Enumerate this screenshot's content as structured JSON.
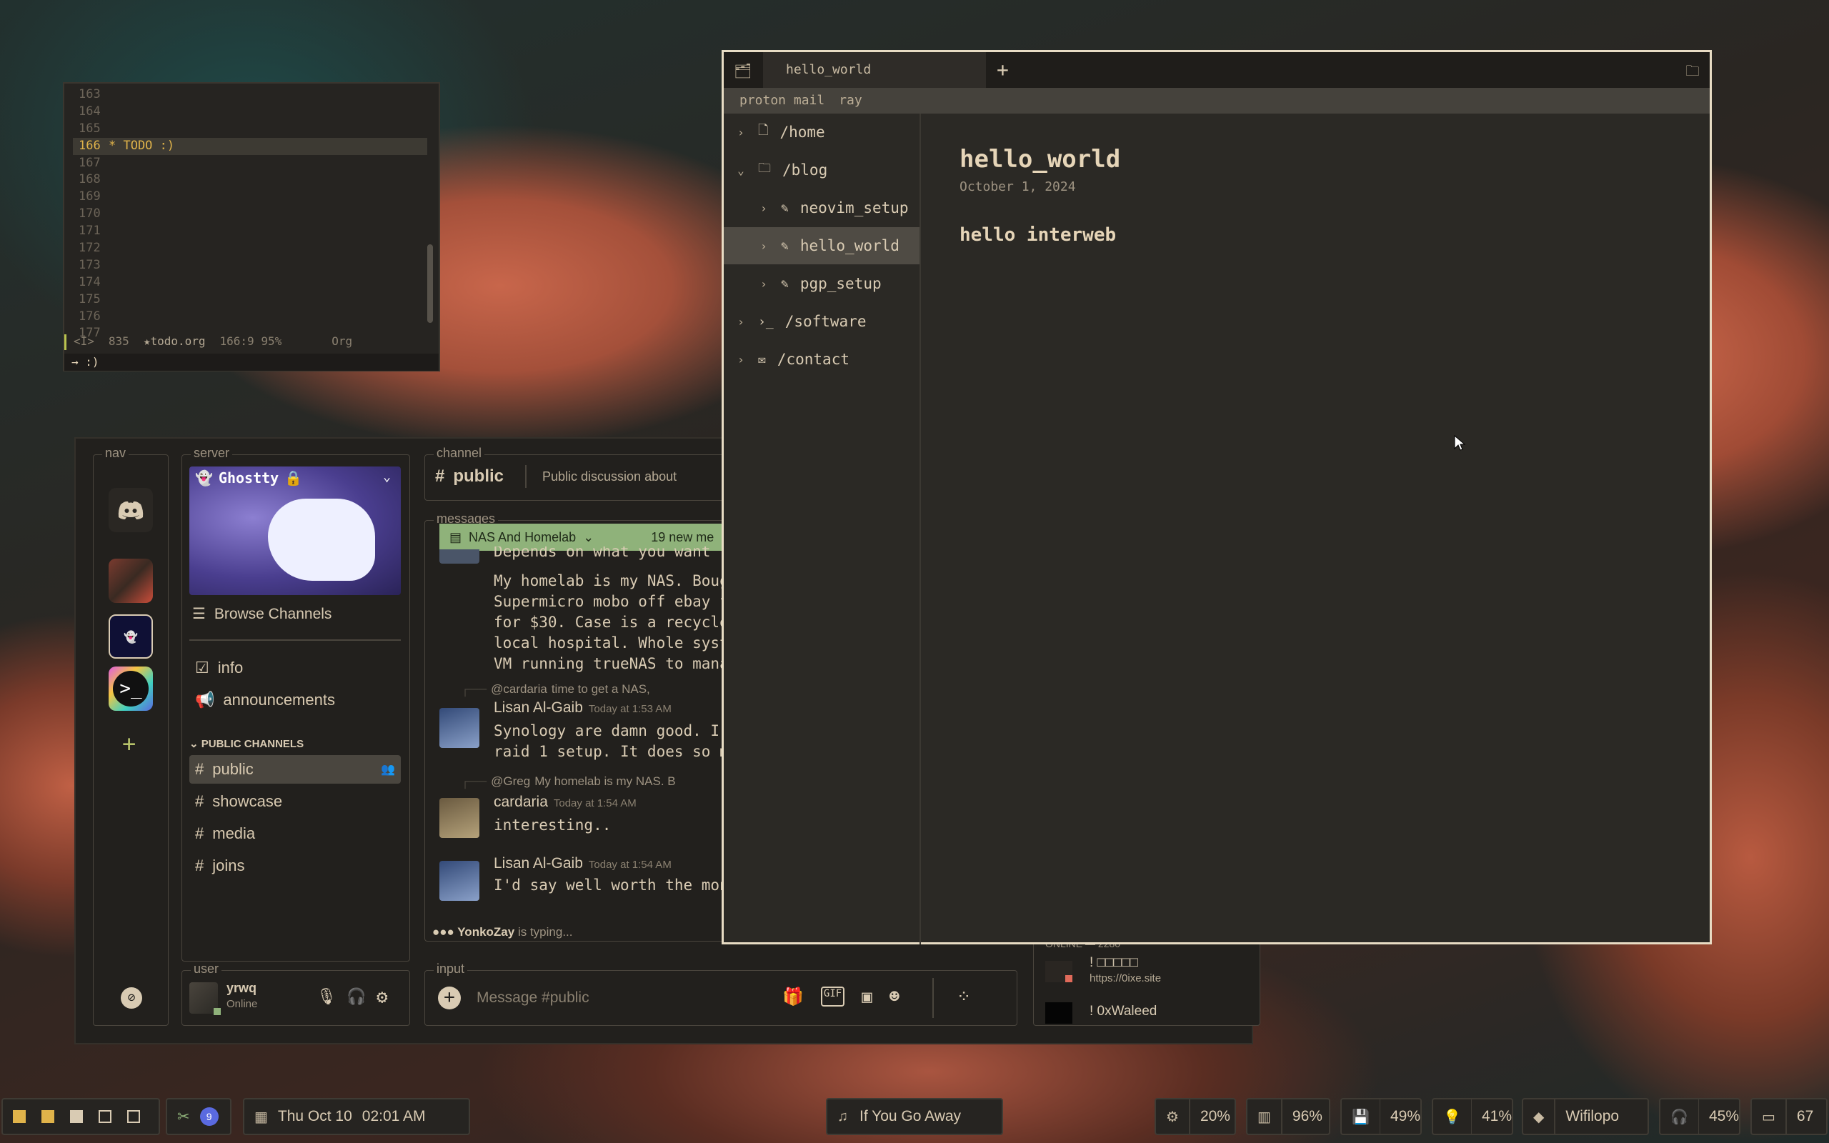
{
  "editor": {
    "lines": [
      {
        "n": "163",
        "t": ""
      },
      {
        "n": "164",
        "t": ""
      },
      {
        "n": "165",
        "t": ""
      },
      {
        "n": "166",
        "t": "* TODO :)",
        "current": true
      },
      {
        "n": "167",
        "t": ""
      },
      {
        "n": "168",
        "t": ""
      },
      {
        "n": "169",
        "t": ""
      },
      {
        "n": "170",
        "t": ""
      },
      {
        "n": "171",
        "t": ""
      },
      {
        "n": "172",
        "t": ""
      },
      {
        "n": "173",
        "t": ""
      },
      {
        "n": "174",
        "t": ""
      },
      {
        "n": "175",
        "t": ""
      },
      {
        "n": "176",
        "t": ""
      },
      {
        "n": "177",
        "t": ""
      }
    ],
    "status": {
      "mode": "<I>",
      "count": "835",
      "file": "★todo.org",
      "pos": "166:9 95%",
      "lang": "Org"
    },
    "cmdline": "→ :)"
  },
  "discord": {
    "labels": {
      "nav": "nav",
      "server": "server",
      "channel": "channel",
      "messages": "messages",
      "user": "user",
      "input": "input"
    },
    "server_name": "Ghostty",
    "browse_channels": "Browse Channels",
    "top_channels": [
      "info",
      "announcements"
    ],
    "section_title": "PUBLIC CHANNELS",
    "channels": [
      "public",
      "showcase",
      "media",
      "joins"
    ],
    "active_channel": "public",
    "channel_header": {
      "name": "public",
      "topic": "Public discussion about"
    },
    "thread_banner": {
      "name": "NAS And Homelab",
      "new": "19 new me"
    },
    "messages": {
      "clipped_top": "Depends on what you want",
      "block1": [
        "My homelab is my NAS. Bough",
        "Supermicro mobo off ebay fo",
        "for $30. Case is a recycled",
        "local hospital. Whole syste",
        "VM running trueNAS to manag"
      ],
      "m1": {
        "reply_to": "@cardaria",
        "reply_text": "time to get a NAS,",
        "user": "Lisan Al-Gaib",
        "time": "Today at 1:53 AM",
        "lines": [
          "Synology are damn good. I h",
          "raid 1 setup. It does so ma"
        ]
      },
      "m2": {
        "reply_to": "@Greg",
        "reply_text": "My homelab is my NAS. B",
        "user": "cardaria",
        "time": "Today at 1:54 AM",
        "lines": [
          "interesting.."
        ]
      },
      "m3": {
        "user": "Lisan Al-Gaib",
        "time": "Today at 1:54 AM",
        "lines": [
          "I'd say well worth the mone"
        ]
      }
    },
    "typing": {
      "user": "YonkoZay",
      "text": "is typing..."
    },
    "user": {
      "name": "yrwq",
      "status": "Online"
    },
    "input_placeholder": "Message #public",
    "members": {
      "header": "ONLINE — 2280",
      "m1_name": "! □□□□□",
      "m1_sub": "https://0ixe.site",
      "m2_name": "! 0xWaleed"
    }
  },
  "browser": {
    "tab_title": "hello_world",
    "bookmarks": [
      "proton mail",
      "ray"
    ],
    "tree": [
      {
        "label": "/home",
        "icon": "file-icon",
        "chev": "›",
        "depth": 0
      },
      {
        "label": "/blog",
        "icon": "folder-icon",
        "chev": "⌄",
        "depth": 0
      },
      {
        "label": "neovim_setup",
        "icon": "pencil-icon",
        "chev": "›",
        "depth": 1
      },
      {
        "label": "hello_world",
        "icon": "pencil-icon",
        "chev": "›",
        "depth": 1,
        "selected": true
      },
      {
        "label": "pgp_setup",
        "icon": "pencil-icon",
        "chev": "›",
        "depth": 1
      },
      {
        "label": "/software",
        "icon": "terminal-icon",
        "chev": "›",
        "depth": 0
      },
      {
        "label": "/contact",
        "icon": "mail-icon",
        "chev": "›",
        "depth": 0
      }
    ],
    "article": {
      "title": "hello_world",
      "date": "October 1, 2024",
      "heading": "hello interweb"
    }
  },
  "taskbar": {
    "clock": {
      "date": "Thu Oct 10",
      "time": "02:01 AM"
    },
    "media": "If You Go Away",
    "cpu": "20%",
    "ram": "96%",
    "disk": "49%",
    "brightness": "41%",
    "wifi": "Wifilopo",
    "volume": "45%",
    "battery": "67",
    "notif_count": "9"
  },
  "colors": {
    "accent": "#e0b34a",
    "thread_banner": "#8fb27a",
    "bg_window": "#22201d"
  }
}
